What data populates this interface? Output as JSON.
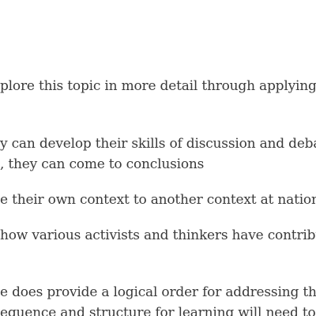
{
  "document": {
    "lines": [
      "plore this topic in more detail through applying a r",
      "y can develop their skills of discussion and debatin",
      ", they can come to conclusions",
      "e their own context to another context at national",
      " how various activists and thinkers have contribut",
      "e does provide a logical order for addressing the",
      "equence and structure for learning will need to b"
    ]
  },
  "colors": {
    "background": "#ffffff",
    "text": "#3a3a3a"
  }
}
